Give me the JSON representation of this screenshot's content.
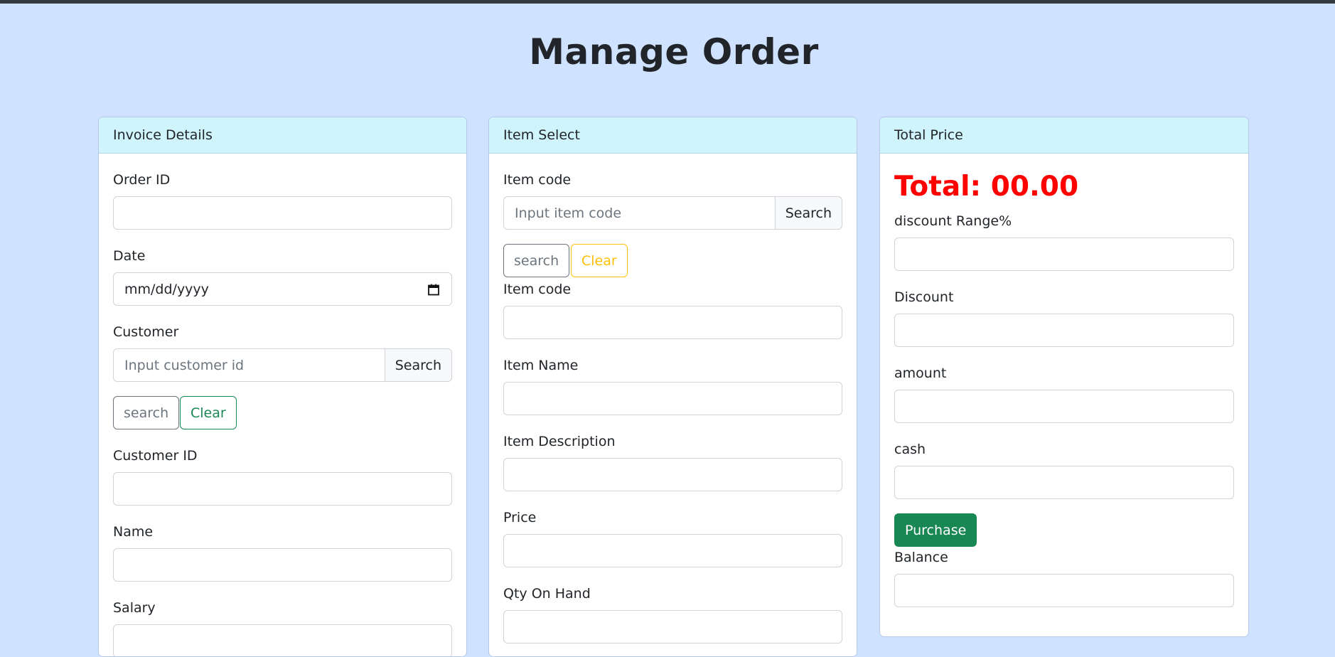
{
  "page": {
    "title": "Manage Order"
  },
  "invoice": {
    "header": "Invoice Details",
    "order_id_label": "Order ID",
    "date_label": "Date",
    "date_placeholder": "mm/dd/yyyy",
    "customer_label": "Customer",
    "customer_search_placeholder": "Input customer id",
    "customer_search_button": "Search",
    "search_button": "search",
    "clear_button": "Clear",
    "customer_id_label": "Customer ID",
    "name_label": "Name",
    "salary_label": "Salary"
  },
  "item": {
    "header": "Item Select",
    "item_code_search_label": "Item code",
    "item_code_placeholder": "Input item code",
    "item_search_button": "Search",
    "search_button": "search",
    "clear_button": "Clear",
    "item_code_label": "Item code",
    "item_name_label": "Item Name",
    "item_description_label": "Item Description",
    "price_label": "Price",
    "qty_label": "Qty On Hand"
  },
  "total": {
    "header": "Total Price",
    "total_text": "Total: 00.00",
    "discount_range_label": "discount Range%",
    "discount_label": "Discount",
    "amount_label": "amount",
    "cash_label": "cash",
    "purchase_button": "Purchase",
    "balance_label": "Balance"
  },
  "colors": {
    "background": "#cfe2ff",
    "card_header": "#cff4fc",
    "success": "#198754",
    "warning": "#ffc107",
    "danger_text": "#ff0000"
  }
}
